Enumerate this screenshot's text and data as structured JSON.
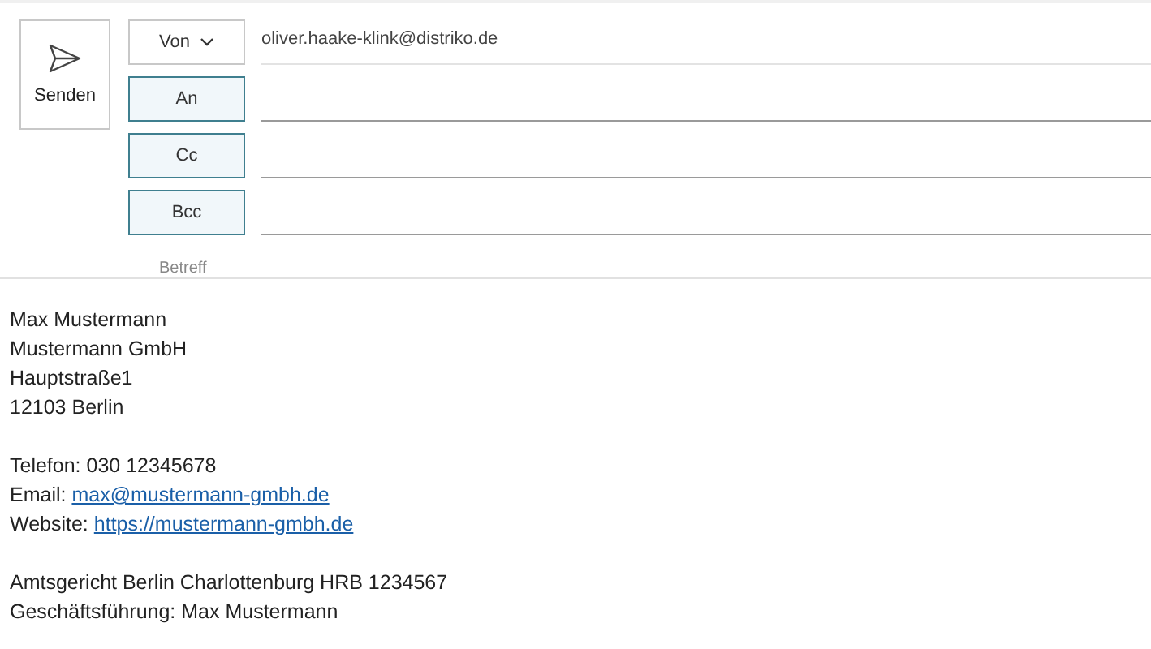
{
  "send_button": {
    "label": "Senden"
  },
  "from": {
    "label": "Von",
    "value": "oliver.haake-klink@distriko.de"
  },
  "recipient_fields": [
    {
      "label": "An"
    },
    {
      "label": "Cc"
    },
    {
      "label": "Bcc"
    }
  ],
  "subject": {
    "placeholder": "Betreff"
  },
  "body": {
    "blocks": [
      [
        {
          "text": "Max Mustermann"
        },
        {
          "text": "Mustermann GmbH"
        },
        {
          "text": "Hauptstraße1"
        },
        {
          "text": "12103 Berlin"
        }
      ],
      [
        {
          "text": "Telefon: 030 12345678"
        },
        {
          "text": "Email:",
          "link": "max@mustermann-gmbh.de"
        },
        {
          "text": "Website:",
          "link": "https://mustermann-gmbh.de"
        }
      ],
      [
        {
          "text": "Amtsgericht Berlin Charlottenburg HRB 1234567"
        },
        {
          "text": "Geschäftsführung: Max Mustermann"
        }
      ]
    ]
  }
}
